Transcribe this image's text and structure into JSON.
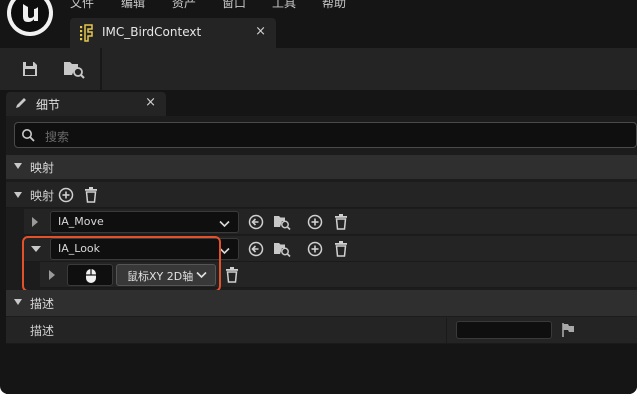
{
  "menubar": {
    "items": [
      "文件",
      "编辑",
      "资产",
      "窗口",
      "工具",
      "帮助"
    ]
  },
  "document_tab": {
    "title": "IMC_BirdContext",
    "close": "×"
  },
  "toolbar": {
    "save_icon": "save-icon",
    "browse_icon": "browse-in-content-browser-icon"
  },
  "details_panel": {
    "tab_title": "细节",
    "close": "×",
    "search": {
      "placeholder": "搜索",
      "value": ""
    }
  },
  "sections": {
    "mappings_header": "映射",
    "mappings_row_label": "映射",
    "description_header": "描述",
    "description_row_label": "描述"
  },
  "mappings": [
    {
      "action": "IA_Move",
      "expanded": false
    },
    {
      "action": "IA_Look",
      "expanded": true,
      "key": {
        "icon": "mouse-icon",
        "axis": "鼠标XY 2D轴"
      }
    }
  ],
  "description": {
    "value": ""
  },
  "colors": {
    "highlight": "#e2502c",
    "panel": "#242424",
    "header": "#2f2f2f",
    "input_bg": "#0f0f0f"
  }
}
